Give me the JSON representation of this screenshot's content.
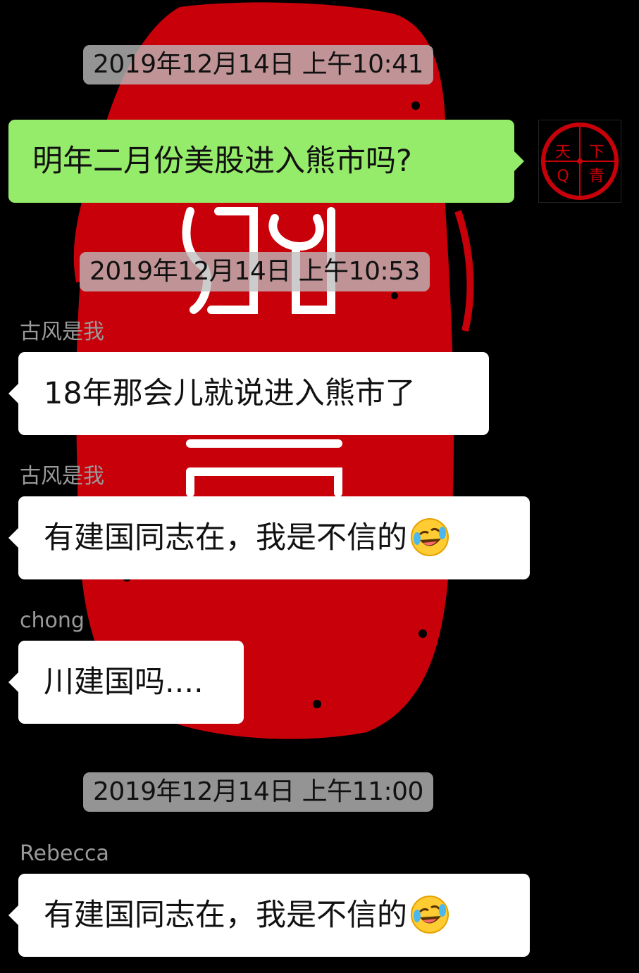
{
  "chat": {
    "messages": [
      {
        "timestamp": "2019年12月14日 上午10:41"
      },
      {
        "outgoing_text": "明年二月份美股进入熊市吗?",
        "avatar_icon": "red-seal-avatar-icon"
      },
      {
        "timestamp": "2019年12月14日 上午10:53"
      },
      {
        "sender": "古风是我",
        "text": "18年那会儿就说进入熊市了"
      },
      {
        "sender": "古风是我",
        "text": "有建国同志在，我是不信的",
        "emoji": "rolling-on-floor-laughing-emoji"
      },
      {
        "sender": "chong",
        "text": "川建国吗...."
      },
      {
        "timestamp": "2019年12月14日 上午11:00"
      },
      {
        "sender": "Rebecca",
        "text": "有建国同志在，我是不信的",
        "emoji": "rolling-on-floor-laughing-emoji"
      }
    ]
  },
  "avatar": {
    "seal_chars": [
      "天",
      "下",
      "Q",
      "青"
    ]
  },
  "colors": {
    "background": "#000000",
    "outgoing_bubble": "#95ec6a",
    "incoming_bubble": "#ffffff",
    "timestamp_pill": "#bebebe",
    "sender_name": "#9a9a9a",
    "seal_red": "#c8000a"
  }
}
